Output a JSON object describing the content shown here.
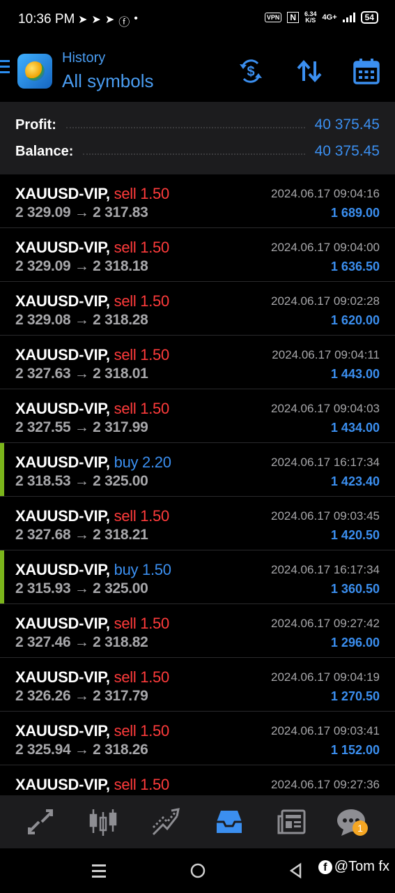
{
  "status_bar": {
    "time": "10:36 PM",
    "vpn": "VPN",
    "speed_value": "6.34",
    "speed_unit": "K/S",
    "network": "4G+",
    "battery": "54"
  },
  "header": {
    "subtitle": "History",
    "title": "All symbols",
    "icons": [
      "dollar-refresh-icon",
      "sort-icon",
      "calendar-icon"
    ]
  },
  "summary": {
    "profit_label": "Profit:",
    "profit_value": "40 375.45",
    "balance_label": "Balance:",
    "balance_value": "40 375.45"
  },
  "trades": [
    {
      "symbol": "XAUUSD-VIP,",
      "side": "sell 1.50",
      "type": "sell",
      "open": "2 329.09",
      "close": "2 317.83",
      "time": "2024.06.17 09:04:16",
      "profit": "1 689.00"
    },
    {
      "symbol": "XAUUSD-VIP,",
      "side": "sell 1.50",
      "type": "sell",
      "open": "2 329.09",
      "close": "2 318.18",
      "time": "2024.06.17 09:04:00",
      "profit": "1 636.50"
    },
    {
      "symbol": "XAUUSD-VIP,",
      "side": "sell 1.50",
      "type": "sell",
      "open": "2 329.08",
      "close": "2 318.28",
      "time": "2024.06.17 09:02:28",
      "profit": "1 620.00"
    },
    {
      "symbol": "XAUUSD-VIP,",
      "side": "sell 1.50",
      "type": "sell",
      "open": "2 327.63",
      "close": "2 318.01",
      "time": "2024.06.17 09:04:11",
      "profit": "1 443.00"
    },
    {
      "symbol": "XAUUSD-VIP,",
      "side": "sell 1.50",
      "type": "sell",
      "open": "2 327.55",
      "close": "2 317.99",
      "time": "2024.06.17 09:04:03",
      "profit": "1 434.00"
    },
    {
      "symbol": "XAUUSD-VIP,",
      "side": "buy 2.20",
      "type": "buy",
      "open": "2 318.53",
      "close": "2 325.00",
      "time": "2024.06.17 16:17:34",
      "profit": "1 423.40"
    },
    {
      "symbol": "XAUUSD-VIP,",
      "side": "sell 1.50",
      "type": "sell",
      "open": "2 327.68",
      "close": "2 318.21",
      "time": "2024.06.17 09:03:45",
      "profit": "1 420.50"
    },
    {
      "symbol": "XAUUSD-VIP,",
      "side": "buy 1.50",
      "type": "buy",
      "open": "2 315.93",
      "close": "2 325.00",
      "time": "2024.06.17 16:17:34",
      "profit": "1 360.50"
    },
    {
      "symbol": "XAUUSD-VIP,",
      "side": "sell 1.50",
      "type": "sell",
      "open": "2 327.46",
      "close": "2 318.82",
      "time": "2024.06.17 09:27:42",
      "profit": "1 296.00"
    },
    {
      "symbol": "XAUUSD-VIP,",
      "side": "sell 1.50",
      "type": "sell",
      "open": "2 326.26",
      "close": "2 317.79",
      "time": "2024.06.17 09:04:19",
      "profit": "1 270.50"
    },
    {
      "symbol": "XAUUSD-VIP,",
      "side": "sell 1.50",
      "type": "sell",
      "open": "2 325.94",
      "close": "2 318.26",
      "time": "2024.06.17 09:03:41",
      "profit": "1 152.00"
    },
    {
      "symbol": "XAUUSD-VIP,",
      "side": "sell 1.50",
      "type": "sell",
      "open": "",
      "close": "",
      "time": "2024.06.17 09:27:36",
      "profit": ""
    }
  ],
  "arrow": "→",
  "bottom_nav": {
    "items": [
      "quotes-icon",
      "chart-icon",
      "trade-icon",
      "history-icon",
      "news-icon",
      "messages-icon"
    ],
    "active": "history-icon",
    "badge": "1"
  },
  "watermark": {
    "fb_glyph": "f",
    "text": "@Tom fx"
  },
  "colors": {
    "accent": "#3b8ff0",
    "sell": "#ff3b3b",
    "buy_marker": "#7bb51b",
    "panel": "#1c1c1e"
  }
}
